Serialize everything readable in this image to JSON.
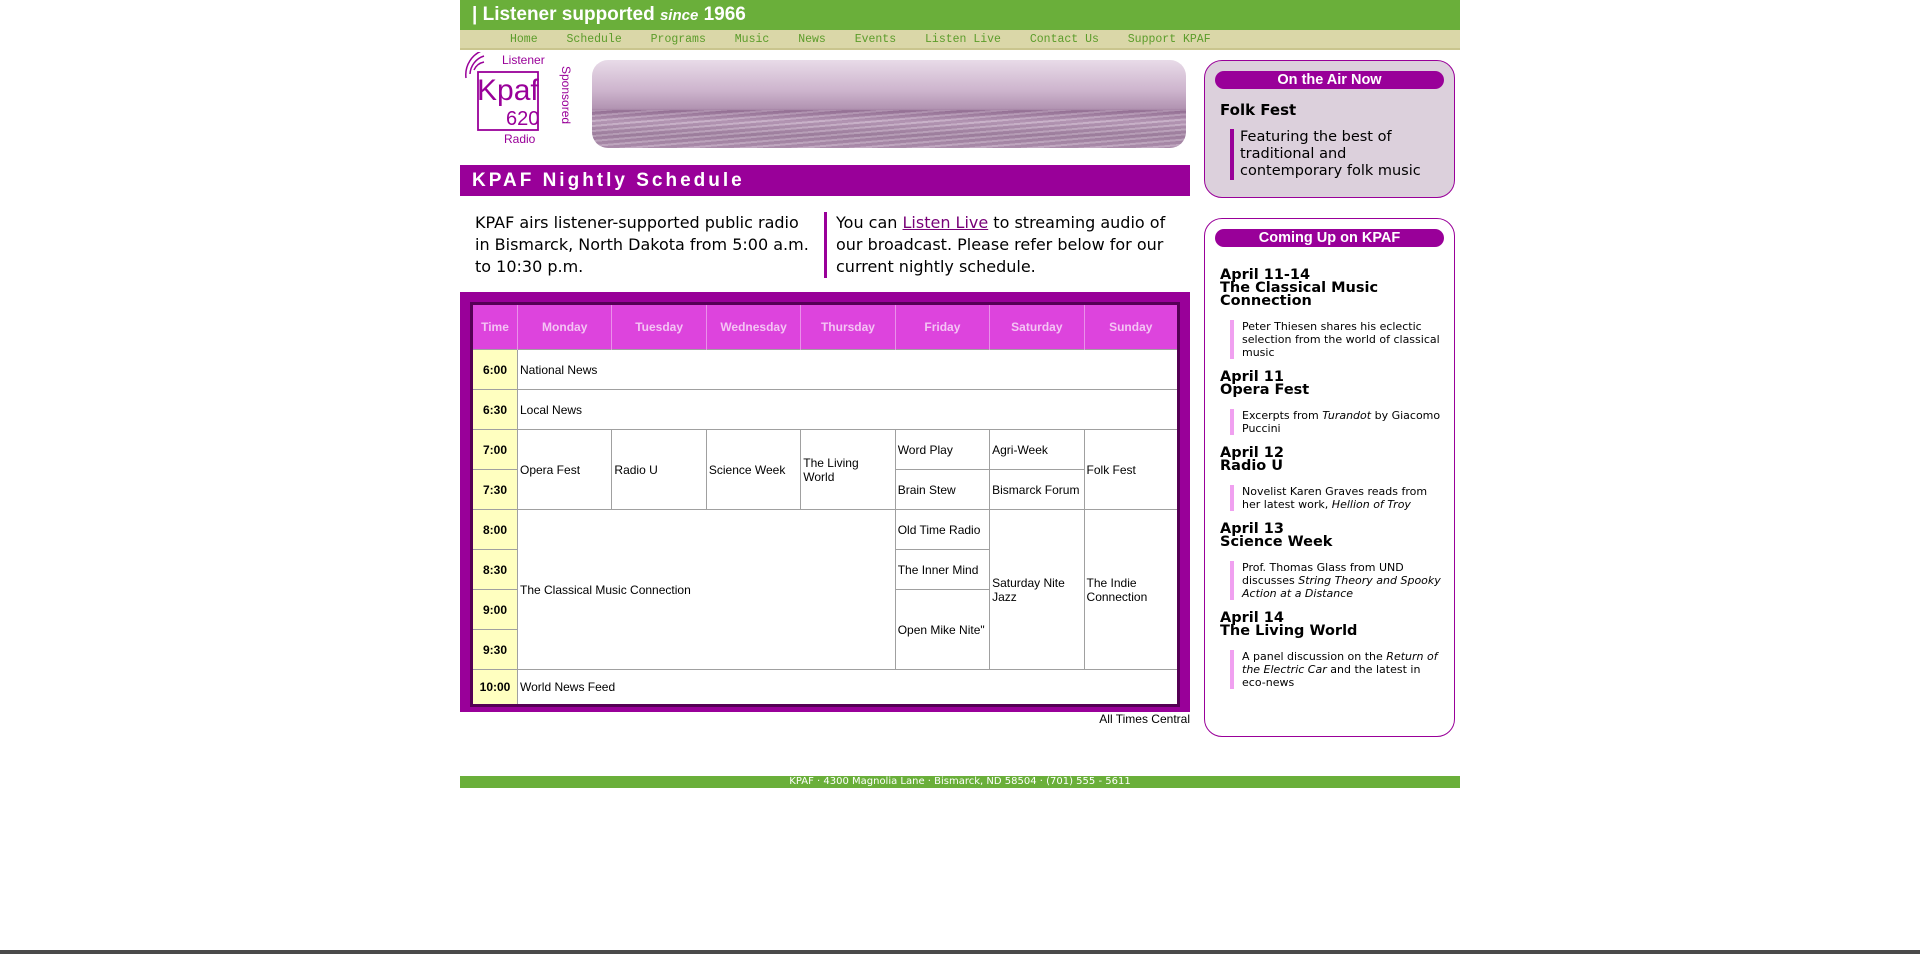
{
  "banner": {
    "pre": "| Listener supported",
    "since": "since",
    "year": "1966"
  },
  "nav": [
    "Home",
    "Schedule",
    "Programs",
    "Music",
    "News",
    "Events",
    "Listen Live",
    "Contact Us",
    "Support KPAF"
  ],
  "logo": {
    "top_text": "Listener",
    "side_text": "Sponsored",
    "bottom_text": "Radio",
    "brand": "Kpaf",
    "number": "620"
  },
  "schedule": {
    "heading": "KPAF Nightly Schedule",
    "intro_left": "KPAF airs listener-supported public radio in Bismarck, North Dakota from 5:00 a.m. to 10:30 p.m.",
    "intro_right_pre": "You can ",
    "intro_right_link": "Listen Live",
    "intro_right_post": " to streaming audio of our broadcast. Please refer below for our current nightly schedule.",
    "headers": [
      "Time",
      "Monday",
      "Tuesday",
      "Wednesday",
      "Thursday",
      "Friday",
      "Saturday",
      "Sunday"
    ],
    "times": [
      "6:00",
      "6:30",
      "7:00",
      "7:30",
      "8:00",
      "8:30",
      "9:00",
      "9:30",
      "10:00"
    ],
    "shows": {
      "national_news": "National News",
      "local_news": "Local News",
      "opera_fest": "Opera Fest",
      "radio_u": "Radio U",
      "science_week": "Science Week",
      "living_world": "The Living World",
      "word_play": "Word Play",
      "agri_week": "Agri-Week",
      "folk_fest": "Folk Fest",
      "brain_stew": "Brain Stew",
      "bismarck_forum": "Bismarck Forum",
      "classical": "The Classical Music Connection",
      "old_time_radio": "Old Time Radio",
      "saturday_nite_jazz": "Saturday Nite Jazz",
      "indie_connection": "The Indie Connection",
      "inner_mind": "The Inner Mind",
      "open_mike": "Open Mike Nite\"",
      "world_news_feed": "World News Feed"
    },
    "note": "All Times Central"
  },
  "on_air": {
    "heading": "On the Air Now",
    "show": "Folk Fest",
    "desc": "Featuring the best of traditional and contemporary folk music"
  },
  "coming_up": {
    "heading": "Coming Up on KPAF",
    "items": [
      {
        "date": "April 11-14",
        "title": "The Classical Music Connection",
        "desc": "Peter Thiesen shares his eclectic selection from the world of classical music"
      },
      {
        "date": "April 11",
        "title": "Opera Fest",
        "desc_pre": "Excerpts from ",
        "desc_em": "Turandot",
        "desc_post": " by Giacomo Puccini"
      },
      {
        "date": "April 12",
        "title": "Radio U",
        "desc_pre": "Novelist Karen Graves reads from her latest work, ",
        "desc_em": "Hellion of Troy",
        "desc_post": ""
      },
      {
        "date": "April 13",
        "title": "Science Week",
        "desc_pre": "Prof. Thomas Glass from UND discusses ",
        "desc_em": "String Theory and Spooky Action at a Distance",
        "desc_post": ""
      },
      {
        "date": "April 14",
        "title": "The Living World",
        "desc_pre": "A panel discussion on the ",
        "desc_em": "Return of the Electric Car",
        "desc_post": " and the latest in eco-news"
      }
    ]
  },
  "footer": "KPAF · 4300 Magnolia Lane · Bismarck, ND 58504 · (701) 555 - 5611",
  "colors": {
    "green": "#6aaf3a",
    "purple": "#990099",
    "magenta": "#dd44dd",
    "time_bg": "#ffffc0",
    "nav_bg": "#dad7a8"
  }
}
